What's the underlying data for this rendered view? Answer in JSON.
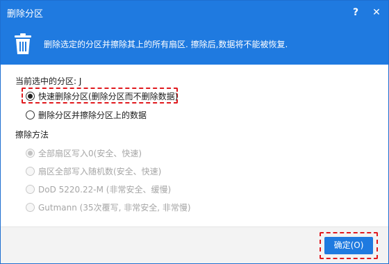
{
  "window": {
    "title": "删除分区",
    "help_label": "?",
    "close_label": "✕"
  },
  "banner": {
    "icon": "trash-icon",
    "text": "删除选定的分区并擦除其上的所有扇区. 擦除后,数据将不能被恢复."
  },
  "selection": {
    "current_partition_label": "当前选中的分区: J"
  },
  "delete_options": [
    {
      "label": "快速删除分区(删除分区而不删除数据)",
      "checked": true
    },
    {
      "label": "删除分区并擦除分区上的数据",
      "checked": false
    }
  ],
  "wipe_method": {
    "heading": "擦除方法",
    "options": [
      {
        "label": "全部扇区写入0(安全、快速)",
        "checked": true,
        "enabled": false
      },
      {
        "label": "扇区全部写入随机数(安全、快速)",
        "checked": false,
        "enabled": false
      },
      {
        "label": "DoD 5220.22-M (非常安全、缓慢)",
        "checked": false,
        "enabled": false
      },
      {
        "label": "Gutmann (35次覆写, 非常安全, 非常慢)",
        "checked": false,
        "enabled": false
      }
    ]
  },
  "footer": {
    "ok_label": "确定(O)"
  },
  "colors": {
    "accent": "#1f7ae0",
    "highlight": "#e0191e"
  }
}
